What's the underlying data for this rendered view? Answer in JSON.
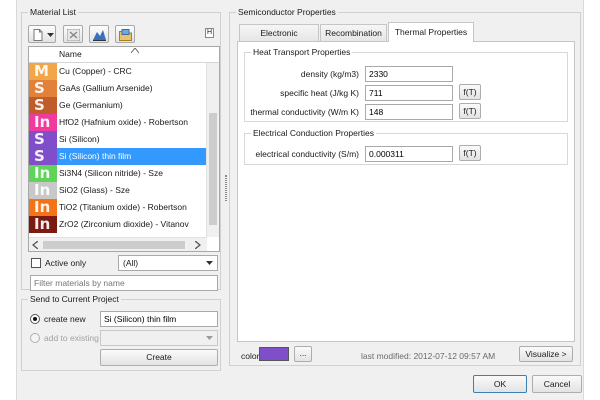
{
  "colors": {
    "accent": "#3399ff",
    "material_color": "#7f4fc9"
  },
  "left": {
    "material_list": {
      "title": "Material List",
      "toolbar": {
        "icons": [
          "new-material-icon",
          "dropdown-arrow-icon",
          "delete-icon",
          "chart-icon",
          "open-folder-icon"
        ],
        "corner_button": "H"
      },
      "column_header": "Name",
      "items": [
        {
          "letter": "M",
          "label": "Cu (Copper) - CRC",
          "color": "#f1a64a"
        },
        {
          "letter": "S",
          "label": "GaAs (Gallium Arsenide)",
          "color": "#e2813a"
        },
        {
          "letter": "S",
          "label": "Ge (Germanium)",
          "color": "#c05b2a"
        },
        {
          "letter": "In",
          "label": "HfO2 (Hafnium oxide) - Robertson",
          "color": "#f03a9e"
        },
        {
          "letter": "S",
          "label": "Si (Silicon)",
          "color": "#7f4fc9"
        },
        {
          "letter": "S",
          "label": "Si (Silicon) thin film",
          "color": "#7f4fc9"
        },
        {
          "letter": "In",
          "label": "Si3N4 (Silicon nitride) - Sze",
          "color": "#5fd35a"
        },
        {
          "letter": "In",
          "label": "SiO2 (Glass) - Sze",
          "color": "#c8c8c8"
        },
        {
          "letter": "In",
          "label": "TiO2 (Titanium oxide) - Robertson",
          "color": "#f37418"
        },
        {
          "letter": "In",
          "label": "ZrO2 (Zirconium dioxide) - Vitanov",
          "color": "#7a1a12"
        }
      ],
      "selected_index": 5
    },
    "filter": {
      "active_only_label": "Active only",
      "type_value": "(All)",
      "filter_placeholder": "Filter materials by name"
    },
    "send": {
      "title": "Send to Current Project",
      "create_new_label": "create new",
      "create_new_value": "Si (Silicon) thin film",
      "add_existing_label": "add to existing",
      "create_button": "Create"
    }
  },
  "right": {
    "title": "Semiconductor Properties",
    "tabs": [
      {
        "label": "Electronic Properties",
        "active": false
      },
      {
        "label": "Recombination",
        "active": false
      },
      {
        "label": "Thermal Properties",
        "active": true
      }
    ],
    "heat": {
      "title": "Heat Transport Properties",
      "rows": [
        {
          "label": "density (kg/m3)",
          "value": "2330",
          "fx": ""
        },
        {
          "label": "specific heat (J/kg K)",
          "value": "711",
          "fx": "f(T)"
        },
        {
          "label": "thermal conductivity (W/m K)",
          "value": "148",
          "fx": "f(T)"
        }
      ]
    },
    "electrical": {
      "title": "Electrical Conduction Properties",
      "rows": [
        {
          "label": "electrical conductivity (S/m)",
          "value": "0.000311",
          "fx": "f(T)"
        }
      ]
    },
    "footer": {
      "color_label": "color",
      "more_button": "...",
      "last_modified": "last modified: 2012-07-12 09:57 AM",
      "visualize_button": "Visualize >"
    }
  },
  "dialog": {
    "ok_label": "OK",
    "cancel_label": "Cancel"
  }
}
